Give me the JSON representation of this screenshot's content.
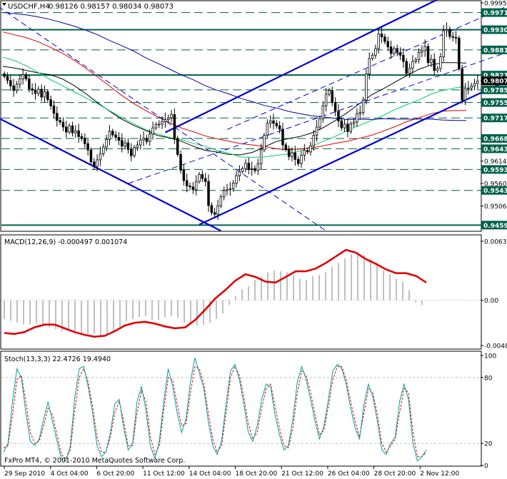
{
  "chart_data": [
    {
      "type": "candlestick",
      "title": "USDCHF,H4",
      "ohlc_header": "0.98126 0.98157 0.98034 0.98073",
      "ylim": [
        0.9445,
        0.9995
      ],
      "price_ticks": [
        "0.99950",
        "0.99716",
        "0.99304",
        "0.98817",
        "0.98211",
        "0.98073",
        "0.97856",
        "0.97551",
        "0.97179",
        "0.96685",
        "0.96437",
        "0.96140",
        "0.95939",
        "0.95600",
        "0.95435",
        "0.95060",
        "0.94599"
      ],
      "highlighted_levels": [
        {
          "value": "0.99716",
          "color": "#00604a"
        },
        {
          "value": "0.99304",
          "color": "#00604a"
        },
        {
          "value": "0.98817",
          "color": "#00604a"
        },
        {
          "value": "0.98211",
          "color": "#00604a"
        },
        {
          "value": "0.98073",
          "color": "#000000"
        },
        {
          "value": "0.97856",
          "color": "#00604a"
        },
        {
          "value": "0.97551",
          "color": "#00604a"
        },
        {
          "value": "0.97179",
          "color": "#00604a"
        },
        {
          "value": "0.96685",
          "color": "#00604a"
        },
        {
          "value": "0.96437",
          "color": "#00604a"
        },
        {
          "value": "0.95939",
          "color": "#00604a"
        },
        {
          "value": "0.95435",
          "color": "#00604a"
        },
        {
          "value": "0.94599",
          "color": "#00604a"
        }
      ],
      "horizontal_levels": {
        "solid": [
          0.99304,
          0.98211,
          0.94599
        ],
        "dashed": [
          0.99716,
          0.98817,
          0.97856,
          0.97551,
          0.97179,
          0.96685,
          0.96437,
          0.95939,
          0.95435
        ]
      },
      "closes": [
        0.9818,
        0.9808,
        0.9795,
        0.9784,
        0.9799,
        0.9812,
        0.9822,
        0.9812,
        0.9788,
        0.9785,
        0.9777,
        0.9787,
        0.9768,
        0.9781,
        0.9762,
        0.9747,
        0.9729,
        0.9712,
        0.9708,
        0.9696,
        0.9684,
        0.9699,
        0.9682,
        0.9687,
        0.9673,
        0.9669,
        0.9656,
        0.9641,
        0.9612,
        0.9601,
        0.9617,
        0.9632,
        0.9648,
        0.9666,
        0.9686,
        0.9677,
        0.9671,
        0.9664,
        0.965,
        0.9658,
        0.9642,
        0.9627,
        0.9647,
        0.9653,
        0.9665,
        0.9669,
        0.9661,
        0.9679,
        0.9694,
        0.9702,
        0.9703,
        0.9709,
        0.9714,
        0.9718,
        0.9726,
        0.9669,
        0.963,
        0.9592,
        0.9567,
        0.9554,
        0.9552,
        0.9545,
        0.9565,
        0.9582,
        0.9572,
        0.9565,
        0.9507,
        0.949,
        0.9486,
        0.9506,
        0.9528,
        0.9543,
        0.9546,
        0.9547,
        0.9561,
        0.9579,
        0.9589,
        0.9596,
        0.9609,
        0.9594,
        0.9596,
        0.9591,
        0.9608,
        0.9641,
        0.9676,
        0.9705,
        0.9711,
        0.9705,
        0.9699,
        0.9691,
        0.9653,
        0.9642,
        0.9625,
        0.9634,
        0.9618,
        0.9608,
        0.9628,
        0.964,
        0.9636,
        0.9651,
        0.9676,
        0.9696,
        0.9716,
        0.9747,
        0.9775,
        0.9784,
        0.9755,
        0.9734,
        0.9711,
        0.9694,
        0.9703,
        0.9685,
        0.9704,
        0.9708,
        0.9728,
        0.9731,
        0.9761,
        0.9824,
        0.9861,
        0.9869,
        0.9885,
        0.992,
        0.9913,
        0.9902,
        0.9889,
        0.9873,
        0.9885,
        0.9875,
        0.9869,
        0.9854,
        0.9825,
        0.9838,
        0.9854,
        0.9858,
        0.9876,
        0.988,
        0.989,
        0.9851,
        0.9859,
        0.9832,
        0.9837,
        0.9865,
        0.9928,
        0.9931,
        0.9914,
        0.9912,
        0.991,
        0.9836,
        0.9761,
        0.9789,
        0.979,
        0.9795,
        0.9801,
        0.9807
      ],
      "indicator_lines": [
        {
          "color": "#000000",
          "values": [
            0.9842,
            0.9838,
            0.9832,
            0.9826,
            0.9822,
            0.9812,
            0.9796,
            0.9776,
            0.9754,
            0.9734,
            0.9715,
            0.97,
            0.9688,
            0.9676,
            0.967,
            0.9662,
            0.965,
            0.964,
            0.9636,
            0.963,
            0.9629,
            0.9635,
            0.9648,
            0.9661,
            0.9668,
            0.9673,
            0.9682,
            0.9695,
            0.9712,
            0.9731,
            0.9752,
            0.9773,
            0.9788,
            0.9804,
            0.982,
            0.9835,
            0.9845,
            0.9851,
            0.9851,
            0.985
          ]
        },
        {
          "color": "#00cc66",
          "values": [
            0.9864,
            0.9856,
            0.9843,
            0.9827,
            0.981,
            0.9796,
            0.9781,
            0.9766,
            0.9752,
            0.9735,
            0.9719,
            0.9704,
            0.969,
            0.968,
            0.9671,
            0.9666,
            0.9657,
            0.965,
            0.964,
            0.9633,
            0.9624,
            0.9623,
            0.9624,
            0.9628,
            0.9631,
            0.9639,
            0.965,
            0.9662,
            0.9674,
            0.9688,
            0.97,
            0.9711,
            0.9724,
            0.9738,
            0.975,
            0.9761,
            0.9775,
            0.9784,
            0.979,
            0.9793
          ]
        },
        {
          "color": "#e00000",
          "values": [
            0.9925,
            0.9918,
            0.9911,
            0.9901,
            0.9888,
            0.9874,
            0.9857,
            0.9837,
            0.9816,
            0.9794,
            0.9772,
            0.9753,
            0.9736,
            0.9721,
            0.9707,
            0.9694,
            0.9685,
            0.9675,
            0.9668,
            0.9662,
            0.9656,
            0.9653,
            0.9649,
            0.9644,
            0.9641,
            0.9643,
            0.9646,
            0.9651,
            0.9657,
            0.9662,
            0.9669,
            0.9676,
            0.9686,
            0.9697,
            0.9709,
            0.9718,
            0.9728,
            0.9734,
            0.9736,
            0.9736
          ]
        },
        {
          "color": "#0000a0",
          "values": [
            0.9972,
            0.9969,
            0.9966,
            0.9961,
            0.9955,
            0.9947,
            0.9939,
            0.9929,
            0.9918,
            0.9904,
            0.9892,
            0.9879,
            0.9863,
            0.985,
            0.9836,
            0.9822,
            0.981,
            0.9796,
            0.9785,
            0.9776,
            0.9765,
            0.9757,
            0.9748,
            0.9742,
            0.9734,
            0.9728,
            0.9723,
            0.972,
            0.9717,
            0.9714,
            0.9715,
            0.9714,
            0.9716,
            0.9715,
            0.9715,
            0.9715,
            0.9715,
            0.9713,
            0.9712,
            0.9712
          ]
        }
      ]
    },
    {
      "type": "macd",
      "label": "MACD(12,26,9) -0.000497 0.001074",
      "ylim": [
        -0.00484,
        0.00632
      ],
      "ticks": [
        "0.00632",
        "0.00",
        "-0.00484"
      ],
      "histogram": [
        -0.002,
        -0.0022,
        -0.0024,
        -0.0026,
        -0.0026,
        -0.0025,
        -0.0027,
        -0.0029,
        -0.0031,
        -0.0033,
        -0.0033,
        -0.0035,
        -0.0037,
        -0.0036,
        -0.0036,
        -0.0038,
        -0.0038,
        -0.0035,
        -0.003,
        -0.0022,
        -0.002,
        -0.0018,
        -0.0017,
        -0.0021,
        -0.0021,
        -0.0018,
        -0.0017,
        -0.0019,
        -0.0024,
        -0.0026,
        -0.0027,
        -0.0026,
        -0.0024,
        -0.002,
        -0.0014,
        -0.0005,
        0.0005,
        0.0012,
        0.0015,
        0.0022,
        0.0025,
        0.003,
        0.0032,
        0.0031,
        0.003,
        0.0027,
        0.0023,
        0.0022,
        0.0026,
        0.0027,
        0.003,
        0.0036,
        0.004,
        0.0045,
        0.0049,
        0.0051,
        0.0048,
        0.0044,
        0.0039,
        0.0032,
        0.0028,
        0.0023,
        0.002,
        0.0011,
        -0.0002,
        -0.0005
      ],
      "signal": [
        -0.0035,
        -0.0036,
        -0.0034,
        -0.0029,
        -0.0026,
        -0.0026,
        -0.003,
        -0.0034,
        -0.0037,
        -0.0039,
        -0.0038,
        -0.0033,
        -0.0027,
        -0.0024,
        -0.0023,
        -0.0025,
        -0.0028,
        -0.003,
        -0.0029,
        -0.0021,
        -0.001,
        0.0002,
        0.0011,
        0.0021,
        0.0028,
        0.0025,
        0.002,
        0.0019,
        0.0025,
        0.0031,
        0.0031,
        0.0034,
        0.004,
        0.0047,
        0.0054,
        0.0051,
        0.0044,
        0.0039,
        0.0033,
        0.0029,
        0.0029,
        0.0026,
        0.0019
      ]
    },
    {
      "type": "stochastic",
      "label": "Stoch(13,3,3) 22.4726 19.4940",
      "ylim": [
        0,
        100
      ],
      "ticks": [
        "100",
        "80",
        "20",
        "0"
      ],
      "main": [
        12,
        20,
        58,
        88,
        80,
        48,
        22,
        18,
        24,
        42,
        58,
        40,
        22,
        6,
        4,
        18,
        62,
        88,
        90,
        72,
        48,
        18,
        8,
        12,
        30,
        56,
        60,
        34,
        14,
        20,
        58,
        72,
        50,
        18,
        6,
        22,
        58,
        88,
        72,
        48,
        30,
        42,
        76,
        98,
        84,
        70,
        40,
        18,
        10,
        22,
        56,
        86,
        92,
        78,
        56,
        30,
        22,
        36,
        60,
        74,
        72,
        46,
        28,
        14,
        18,
        42,
        76,
        90,
        78,
        60,
        40,
        24,
        36,
        60,
        86,
        92,
        88,
        74,
        52,
        34,
        24,
        56,
        74,
        62,
        40,
        14,
        10,
        20,
        26,
        58,
        74,
        60,
        20,
        4,
        8,
        14
      ],
      "signal": [
        16,
        18,
        46,
        78,
        82,
        58,
        30,
        20,
        22,
        36,
        52,
        46,
        28,
        10,
        6,
        14,
        50,
        80,
        88,
        76,
        54,
        26,
        12,
        12,
        26,
        48,
        58,
        40,
        18,
        18,
        48,
        68,
        58,
        26,
        10,
        18,
        50,
        80,
        78,
        56,
        36,
        38,
        66,
        90,
        88,
        74,
        48,
        24,
        12,
        18,
        48,
        80,
        90,
        82,
        62,
        38,
        24,
        30,
        52,
        70,
        74,
        54,
        34,
        18,
        16,
        34,
        66,
        86,
        82,
        66,
        46,
        28,
        32,
        54,
        78,
        90,
        90,
        78,
        58,
        40,
        26,
        48,
        70,
        66,
        46,
        20,
        12,
        18,
        24,
        48,
        70,
        66,
        30,
        8,
        8,
        12
      ]
    }
  ],
  "x_axis_labels": [
    "29 Sep 2010",
    "4 Oct 04:00",
    "6 Oct 20:00",
    "11 Oct 12:00",
    "14 Oct 04:00",
    "18 Oct 20:00",
    "21 Oct 12:00",
    "26 Oct 04:00",
    "28 Oct 20:00",
    "2 Nov 12:00"
  ],
  "copyright": "FxPro MT4, © 2001-2010 MetaQuotes Software Corp.",
  "colors": {
    "bull_candle": "#ffffff",
    "bear_candle": "#000000",
    "trend_channel": "#0000d0",
    "grid_dash": "#00604a",
    "macd_signal": "#e00000",
    "macd_hist": "#c0c0c0",
    "stoch_main": "#00a0a0",
    "stoch_signal": "#e00000"
  }
}
